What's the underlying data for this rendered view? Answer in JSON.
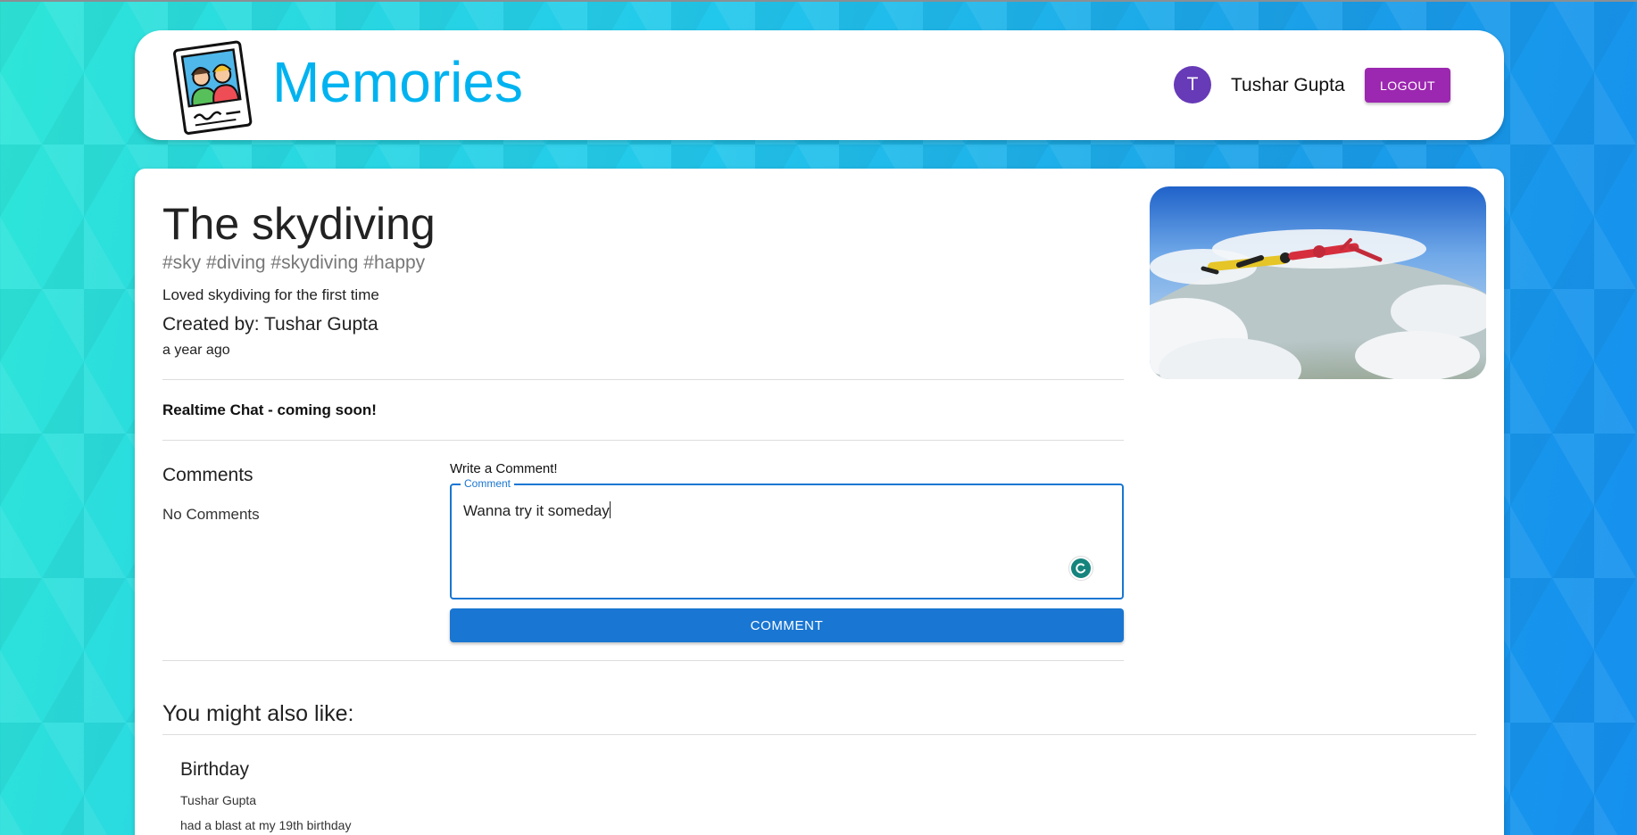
{
  "header": {
    "brand": "Memories",
    "user_initial": "T",
    "user_name": "Tushar Gupta",
    "logout_label": "LOGOUT"
  },
  "post": {
    "title": "The skydiving",
    "tags": "#sky #diving #skydiving #happy",
    "message": "Loved skydiving for the first time",
    "created_by": "Created by: Tushar Gupta",
    "time_ago": "a year ago",
    "chat_note": "Realtime Chat - coming soon!"
  },
  "comments": {
    "heading": "Comments",
    "empty_text": "No Comments",
    "write_label": "Write a Comment!",
    "field_label": "Comment",
    "field_value": "Wanna try it someday",
    "submit_label": "COMMENT"
  },
  "recommendations": {
    "heading": "You might also like:",
    "items": [
      {
        "title": "Birthday",
        "author": "Tushar Gupta",
        "message": "had a blast at my 19th birthday"
      }
    ]
  },
  "colors": {
    "brand": "#00b3f0",
    "avatar": "#673ab7",
    "logout": "#9c27b0",
    "primary": "#1976d2",
    "grammar_badge": "#15847d"
  },
  "icons": {
    "logo": "memories-photo-logo-icon",
    "grammar": "grammar-assistant-icon"
  }
}
